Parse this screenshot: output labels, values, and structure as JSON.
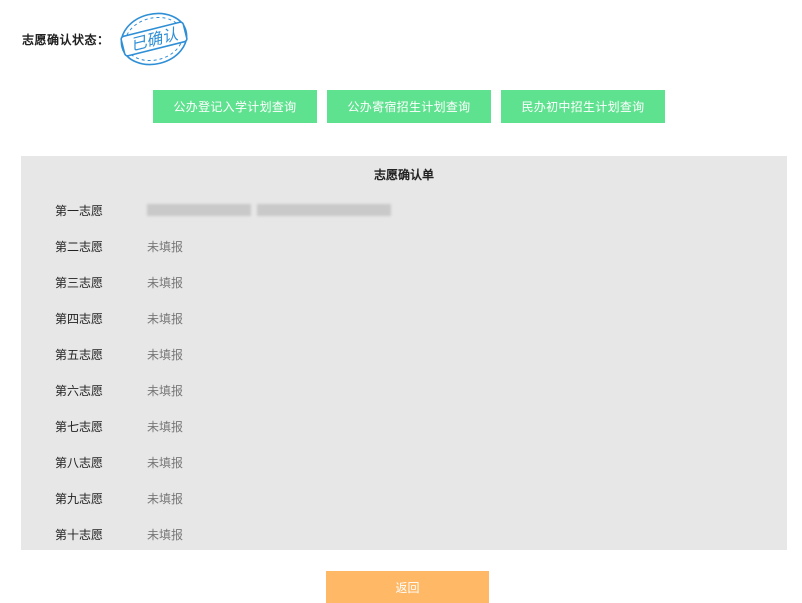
{
  "status": {
    "label": "志愿确认状态：",
    "stamp_text": "已确认"
  },
  "actions": {
    "btn_public_registered": "公办登记入学计划查询",
    "btn_public_boarding": "公办寄宿招生计划查询",
    "btn_private_junior": "民办初中招生计划查询"
  },
  "form": {
    "title": "志愿确认单",
    "rows": [
      {
        "label": "第一志愿",
        "value": ""
      },
      {
        "label": "第二志愿",
        "value": "未填报"
      },
      {
        "label": "第三志愿",
        "value": "未填报"
      },
      {
        "label": "第四志愿",
        "value": "未填报"
      },
      {
        "label": "第五志愿",
        "value": "未填报"
      },
      {
        "label": "第六志愿",
        "value": "未填报"
      },
      {
        "label": "第七志愿",
        "value": "未填报"
      },
      {
        "label": "第八志愿",
        "value": "未填报"
      },
      {
        "label": "第九志愿",
        "value": "未填报"
      },
      {
        "label": "第十志愿",
        "value": "未填报"
      }
    ]
  },
  "footer": {
    "back_label": "返回"
  },
  "colors": {
    "green_button": "#5fe28f",
    "orange_button": "#ffb866",
    "panel_bg": "#e7e7e7",
    "stamp_blue": "#2f8fd6"
  }
}
